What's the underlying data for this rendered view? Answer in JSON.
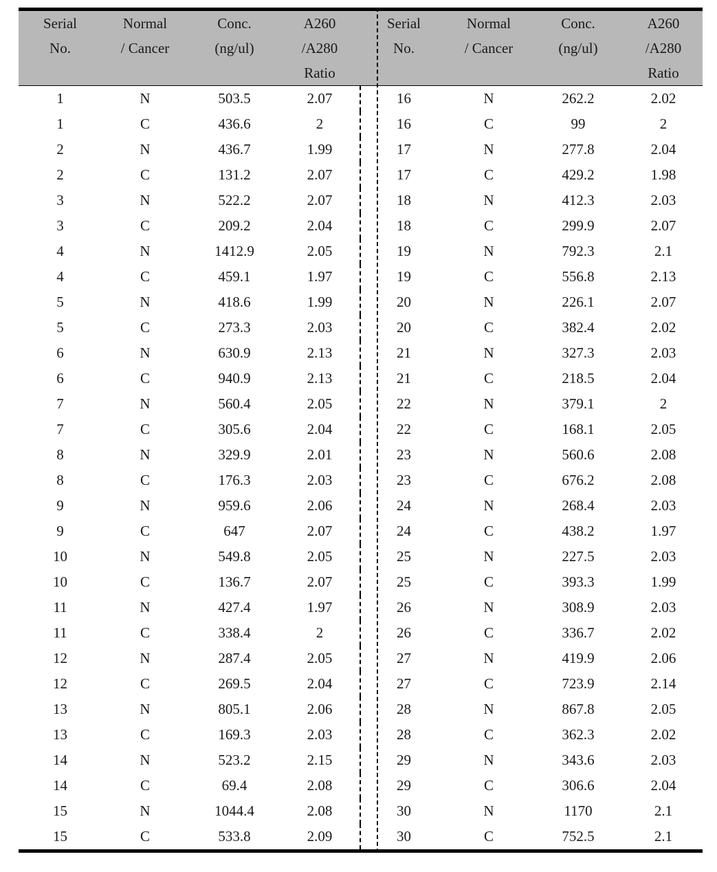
{
  "table": {
    "header": {
      "columns": [
        {
          "line1": "Serial",
          "line2": "No.",
          "line3": ""
        },
        {
          "line1": "Normal",
          "line2": "/ Cancer",
          "line3": ""
        },
        {
          "line1": "Conc.",
          "line2": "(ng/ul)",
          "line3": ""
        },
        {
          "line1": "A260",
          "line2": "/A280",
          "line3": "Ratio"
        }
      ]
    },
    "colors": {
      "header_background": "#b8b8b8",
      "rule": "#000000",
      "text": "#1a1a1a",
      "page_background": "#ffffff"
    },
    "divider": "dashed-vertical",
    "rows": [
      {
        "l_serial": "1",
        "l_type": "N",
        "l_conc": "503.5",
        "l_ratio": "2.07",
        "r_serial": "16",
        "r_type": "N",
        "r_conc": "262.2",
        "r_ratio": "2.02"
      },
      {
        "l_serial": "1",
        "l_type": "C",
        "l_conc": "436.6",
        "l_ratio": "2",
        "r_serial": "16",
        "r_type": "C",
        "r_conc": "99",
        "r_ratio": "2"
      },
      {
        "l_serial": "2",
        "l_type": "N",
        "l_conc": "436.7",
        "l_ratio": "1.99",
        "r_serial": "17",
        "r_type": "N",
        "r_conc": "277.8",
        "r_ratio": "2.04"
      },
      {
        "l_serial": "2",
        "l_type": "C",
        "l_conc": "131.2",
        "l_ratio": "2.07",
        "r_serial": "17",
        "r_type": "C",
        "r_conc": "429.2",
        "r_ratio": "1.98"
      },
      {
        "l_serial": "3",
        "l_type": "N",
        "l_conc": "522.2",
        "l_ratio": "2.07",
        "r_serial": "18",
        "r_type": "N",
        "r_conc": "412.3",
        "r_ratio": "2.03"
      },
      {
        "l_serial": "3",
        "l_type": "C",
        "l_conc": "209.2",
        "l_ratio": "2.04",
        "r_serial": "18",
        "r_type": "C",
        "r_conc": "299.9",
        "r_ratio": "2.07"
      },
      {
        "l_serial": "4",
        "l_type": "N",
        "l_conc": "1412.9",
        "l_ratio": "2.05",
        "r_serial": "19",
        "r_type": "N",
        "r_conc": "792.3",
        "r_ratio": "2.1"
      },
      {
        "l_serial": "4",
        "l_type": "C",
        "l_conc": "459.1",
        "l_ratio": "1.97",
        "r_serial": "19",
        "r_type": "C",
        "r_conc": "556.8",
        "r_ratio": "2.13"
      },
      {
        "l_serial": "5",
        "l_type": "N",
        "l_conc": "418.6",
        "l_ratio": "1.99",
        "r_serial": "20",
        "r_type": "N",
        "r_conc": "226.1",
        "r_ratio": "2.07"
      },
      {
        "l_serial": "5",
        "l_type": "C",
        "l_conc": "273.3",
        "l_ratio": "2.03",
        "r_serial": "20",
        "r_type": "C",
        "r_conc": "382.4",
        "r_ratio": "2.02"
      },
      {
        "l_serial": "6",
        "l_type": "N",
        "l_conc": "630.9",
        "l_ratio": "2.13",
        "r_serial": "21",
        "r_type": "N",
        "r_conc": "327.3",
        "r_ratio": "2.03"
      },
      {
        "l_serial": "6",
        "l_type": "C",
        "l_conc": "940.9",
        "l_ratio": "2.13",
        "r_serial": "21",
        "r_type": "C",
        "r_conc": "218.5",
        "r_ratio": "2.04"
      },
      {
        "l_serial": "7",
        "l_type": "N",
        "l_conc": "560.4",
        "l_ratio": "2.05",
        "r_serial": "22",
        "r_type": "N",
        "r_conc": "379.1",
        "r_ratio": "2"
      },
      {
        "l_serial": "7",
        "l_type": "C",
        "l_conc": "305.6",
        "l_ratio": "2.04",
        "r_serial": "22",
        "r_type": "C",
        "r_conc": "168.1",
        "r_ratio": "2.05"
      },
      {
        "l_serial": "8",
        "l_type": "N",
        "l_conc": "329.9",
        "l_ratio": "2.01",
        "r_serial": "23",
        "r_type": "N",
        "r_conc": "560.6",
        "r_ratio": "2.08"
      },
      {
        "l_serial": "8",
        "l_type": "C",
        "l_conc": "176.3",
        "l_ratio": "2.03",
        "r_serial": "23",
        "r_type": "C",
        "r_conc": "676.2",
        "r_ratio": "2.08"
      },
      {
        "l_serial": "9",
        "l_type": "N",
        "l_conc": "959.6",
        "l_ratio": "2.06",
        "r_serial": "24",
        "r_type": "N",
        "r_conc": "268.4",
        "r_ratio": "2.03"
      },
      {
        "l_serial": "9",
        "l_type": "C",
        "l_conc": "647",
        "l_ratio": "2.07",
        "r_serial": "24",
        "r_type": "C",
        "r_conc": "438.2",
        "r_ratio": "1.97"
      },
      {
        "l_serial": "10",
        "l_type": "N",
        "l_conc": "549.8",
        "l_ratio": "2.05",
        "r_serial": "25",
        "r_type": "N",
        "r_conc": "227.5",
        "r_ratio": "2.03"
      },
      {
        "l_serial": "10",
        "l_type": "C",
        "l_conc": "136.7",
        "l_ratio": "2.07",
        "r_serial": "25",
        "r_type": "C",
        "r_conc": "393.3",
        "r_ratio": "1.99"
      },
      {
        "l_serial": "11",
        "l_type": "N",
        "l_conc": "427.4",
        "l_ratio": "1.97",
        "r_serial": "26",
        "r_type": "N",
        "r_conc": "308.9",
        "r_ratio": "2.03"
      },
      {
        "l_serial": "11",
        "l_type": "C",
        "l_conc": "338.4",
        "l_ratio": "2",
        "r_serial": "26",
        "r_type": "C",
        "r_conc": "336.7",
        "r_ratio": "2.02"
      },
      {
        "l_serial": "12",
        "l_type": "N",
        "l_conc": "287.4",
        "l_ratio": "2.05",
        "r_serial": "27",
        "r_type": "N",
        "r_conc": "419.9",
        "r_ratio": "2.06"
      },
      {
        "l_serial": "12",
        "l_type": "C",
        "l_conc": "269.5",
        "l_ratio": "2.04",
        "r_serial": "27",
        "r_type": "C",
        "r_conc": "723.9",
        "r_ratio": "2.14"
      },
      {
        "l_serial": "13",
        "l_type": "N",
        "l_conc": "805.1",
        "l_ratio": "2.06",
        "r_serial": "28",
        "r_type": "N",
        "r_conc": "867.8",
        "r_ratio": "2.05"
      },
      {
        "l_serial": "13",
        "l_type": "C",
        "l_conc": "169.3",
        "l_ratio": "2.03",
        "r_serial": "28",
        "r_type": "C",
        "r_conc": "362.3",
        "r_ratio": "2.02"
      },
      {
        "l_serial": "14",
        "l_type": "N",
        "l_conc": "523.2",
        "l_ratio": "2.15",
        "r_serial": "29",
        "r_type": "N",
        "r_conc": "343.6",
        "r_ratio": "2.03"
      },
      {
        "l_serial": "14",
        "l_type": "C",
        "l_conc": "69.4",
        "l_ratio": "2.08",
        "r_serial": "29",
        "r_type": "C",
        "r_conc": "306.6",
        "r_ratio": "2.04"
      },
      {
        "l_serial": "15",
        "l_type": "N",
        "l_conc": "1044.4",
        "l_ratio": "2.08",
        "r_serial": "30",
        "r_type": "N",
        "r_conc": "1170",
        "r_ratio": "2.1"
      },
      {
        "l_serial": "15",
        "l_type": "C",
        "l_conc": "533.8",
        "l_ratio": "2.09",
        "r_serial": "30",
        "r_type": "C",
        "r_conc": "752.5",
        "r_ratio": "2.1"
      }
    ]
  }
}
